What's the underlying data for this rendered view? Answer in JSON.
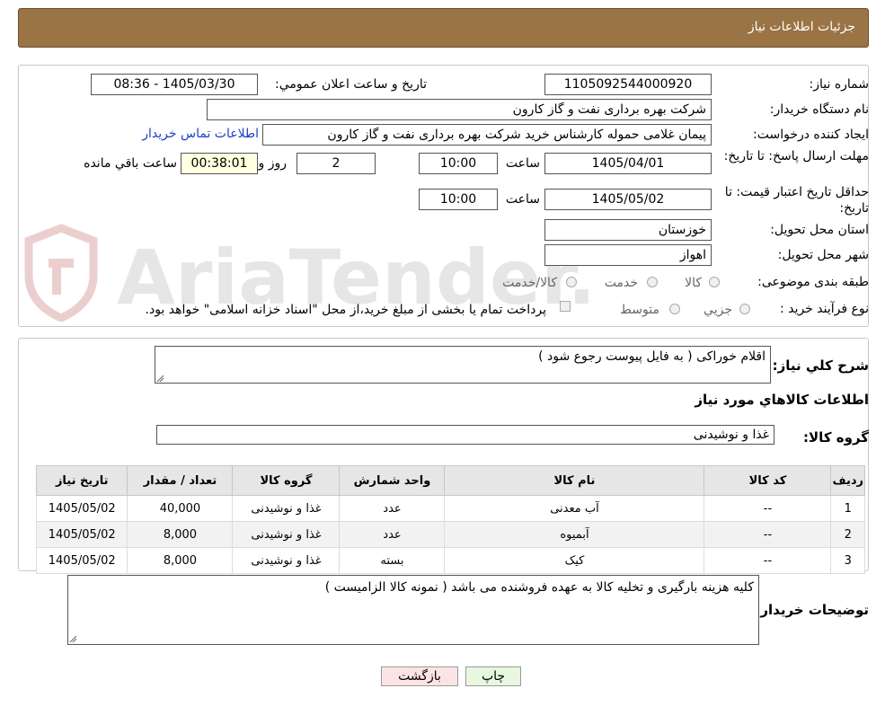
{
  "header": {
    "title": "جزئیات اطلاعات نیاز"
  },
  "form": {
    "need_number_label": "شماره نیاز:",
    "need_number": "1105092544000920",
    "announce_label": "تاریخ و ساعت اعلان عمومي:",
    "announce_value": "1405/03/30 - 08:36",
    "buyer_org_label": "نام دستگاه خريدار:",
    "buyer_org": "شرکت بهره برداری نفت و گاز کارون",
    "requester_label": "ايجاد کننده درخواست:",
    "requester": "پیمان غلامی حموله کارشناس خرید شرکت بهره برداری نفت و گاز کارون",
    "contact_link": "اطلاعات تماس خريدار",
    "deadline_label": "مهلت ارسال پاسخ: تا تاريخ:",
    "deadline_date": "1405/04/01",
    "time_label": "ساعت",
    "deadline_time": "10:00",
    "days_value": "2",
    "days_label": "روز و",
    "remaining_time": "00:38:01",
    "remaining_label": "ساعت باقي مانده",
    "validity_label": "حداقل تاريخ اعتبار قيمت: تا تاريخ:",
    "validity_date": "1405/05/02",
    "validity_time": "10:00",
    "province_label": "استان محل تحويل:",
    "province": "خوزستان",
    "city_label": "شهر محل تحويل:",
    "city": "اهواز",
    "category_label": "طبقه بندی موضوعی:",
    "category_options": [
      "کالا",
      "خدمت",
      "کالا/خدمت"
    ],
    "process_label": "نوع فرآيند خريد :",
    "process_options": [
      "جزيي",
      "متوسط"
    ],
    "payment_note": "پرداخت تمام يا بخشی از مبلغ خريد،از محل \"اسناد خزانه اسلامی\" خواهد بود."
  },
  "description": {
    "label": "شرح كلي نياز:",
    "value": "اقلام خوراکی ( به فایل پیوست رجوع شود )"
  },
  "items_section": {
    "title": "اطلاعات كالاهاي مورد نياز",
    "group_label": "گروه كالا:",
    "group_value": "غذا و نوشیدنی"
  },
  "table": {
    "headers": [
      "رديف",
      "كد كالا",
      "نام كالا",
      "واحد شمارش",
      "گروه كالا",
      "تعداد / مقدار",
      "تاريخ نياز"
    ],
    "rows": [
      [
        "1",
        "--",
        "آب معدنی",
        "عدد",
        "غذا و نوشیدنی",
        "40,000",
        "1405/05/02"
      ],
      [
        "2",
        "--",
        "آبمیوه",
        "عدد",
        "غذا و نوشیدنی",
        "8,000",
        "1405/05/02"
      ],
      [
        "3",
        "--",
        "کیک",
        "بسته",
        "غذا و نوشیدنی",
        "8,000",
        "1405/05/02"
      ]
    ]
  },
  "buyer_notes": {
    "label": "توضيحات خريدار:",
    "value": "کلیه هزینه بارگیری و تخلیه کالا به عهده فروشنده می باشد ( نمونه کالا الزامیست )"
  },
  "buttons": {
    "print": "چاپ",
    "back": "بازگشت"
  },
  "watermark": {
    "text": "AriaTender.neT"
  },
  "colors": {
    "header_bg": "#9a7444",
    "link": "#1a3ec7",
    "back_btn_bg": "#fde4e4",
    "print_btn_bg": "#e8f8e0",
    "remaining_bg": "#ffffe1"
  }
}
